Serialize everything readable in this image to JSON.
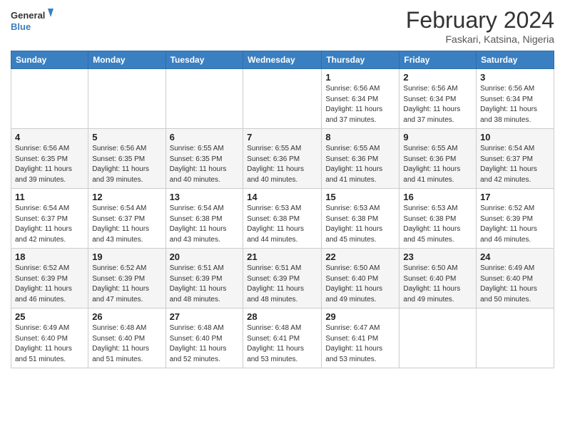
{
  "logo": {
    "line1": "General",
    "line2": "Blue"
  },
  "title": "February 2024",
  "location": "Faskari, Katsina, Nigeria",
  "days_of_week": [
    "Sunday",
    "Monday",
    "Tuesday",
    "Wednesday",
    "Thursday",
    "Friday",
    "Saturday"
  ],
  "weeks": [
    [
      {
        "day": "",
        "info": ""
      },
      {
        "day": "",
        "info": ""
      },
      {
        "day": "",
        "info": ""
      },
      {
        "day": "",
        "info": ""
      },
      {
        "day": "1",
        "info": "Sunrise: 6:56 AM\nSunset: 6:34 PM\nDaylight: 11 hours and 37 minutes."
      },
      {
        "day": "2",
        "info": "Sunrise: 6:56 AM\nSunset: 6:34 PM\nDaylight: 11 hours and 37 minutes."
      },
      {
        "day": "3",
        "info": "Sunrise: 6:56 AM\nSunset: 6:34 PM\nDaylight: 11 hours and 38 minutes."
      }
    ],
    [
      {
        "day": "4",
        "info": "Sunrise: 6:56 AM\nSunset: 6:35 PM\nDaylight: 11 hours and 39 minutes."
      },
      {
        "day": "5",
        "info": "Sunrise: 6:56 AM\nSunset: 6:35 PM\nDaylight: 11 hours and 39 minutes."
      },
      {
        "day": "6",
        "info": "Sunrise: 6:55 AM\nSunset: 6:35 PM\nDaylight: 11 hours and 40 minutes."
      },
      {
        "day": "7",
        "info": "Sunrise: 6:55 AM\nSunset: 6:36 PM\nDaylight: 11 hours and 40 minutes."
      },
      {
        "day": "8",
        "info": "Sunrise: 6:55 AM\nSunset: 6:36 PM\nDaylight: 11 hours and 41 minutes."
      },
      {
        "day": "9",
        "info": "Sunrise: 6:55 AM\nSunset: 6:36 PM\nDaylight: 11 hours and 41 minutes."
      },
      {
        "day": "10",
        "info": "Sunrise: 6:54 AM\nSunset: 6:37 PM\nDaylight: 11 hours and 42 minutes."
      }
    ],
    [
      {
        "day": "11",
        "info": "Sunrise: 6:54 AM\nSunset: 6:37 PM\nDaylight: 11 hours and 42 minutes."
      },
      {
        "day": "12",
        "info": "Sunrise: 6:54 AM\nSunset: 6:37 PM\nDaylight: 11 hours and 43 minutes."
      },
      {
        "day": "13",
        "info": "Sunrise: 6:54 AM\nSunset: 6:38 PM\nDaylight: 11 hours and 43 minutes."
      },
      {
        "day": "14",
        "info": "Sunrise: 6:53 AM\nSunset: 6:38 PM\nDaylight: 11 hours and 44 minutes."
      },
      {
        "day": "15",
        "info": "Sunrise: 6:53 AM\nSunset: 6:38 PM\nDaylight: 11 hours and 45 minutes."
      },
      {
        "day": "16",
        "info": "Sunrise: 6:53 AM\nSunset: 6:38 PM\nDaylight: 11 hours and 45 minutes."
      },
      {
        "day": "17",
        "info": "Sunrise: 6:52 AM\nSunset: 6:39 PM\nDaylight: 11 hours and 46 minutes."
      }
    ],
    [
      {
        "day": "18",
        "info": "Sunrise: 6:52 AM\nSunset: 6:39 PM\nDaylight: 11 hours and 46 minutes."
      },
      {
        "day": "19",
        "info": "Sunrise: 6:52 AM\nSunset: 6:39 PM\nDaylight: 11 hours and 47 minutes."
      },
      {
        "day": "20",
        "info": "Sunrise: 6:51 AM\nSunset: 6:39 PM\nDaylight: 11 hours and 48 minutes."
      },
      {
        "day": "21",
        "info": "Sunrise: 6:51 AM\nSunset: 6:39 PM\nDaylight: 11 hours and 48 minutes."
      },
      {
        "day": "22",
        "info": "Sunrise: 6:50 AM\nSunset: 6:40 PM\nDaylight: 11 hours and 49 minutes."
      },
      {
        "day": "23",
        "info": "Sunrise: 6:50 AM\nSunset: 6:40 PM\nDaylight: 11 hours and 49 minutes."
      },
      {
        "day": "24",
        "info": "Sunrise: 6:49 AM\nSunset: 6:40 PM\nDaylight: 11 hours and 50 minutes."
      }
    ],
    [
      {
        "day": "25",
        "info": "Sunrise: 6:49 AM\nSunset: 6:40 PM\nDaylight: 11 hours and 51 minutes."
      },
      {
        "day": "26",
        "info": "Sunrise: 6:48 AM\nSunset: 6:40 PM\nDaylight: 11 hours and 51 minutes."
      },
      {
        "day": "27",
        "info": "Sunrise: 6:48 AM\nSunset: 6:40 PM\nDaylight: 11 hours and 52 minutes."
      },
      {
        "day": "28",
        "info": "Sunrise: 6:48 AM\nSunset: 6:41 PM\nDaylight: 11 hours and 53 minutes."
      },
      {
        "day": "29",
        "info": "Sunrise: 6:47 AM\nSunset: 6:41 PM\nDaylight: 11 hours and 53 minutes."
      },
      {
        "day": "",
        "info": ""
      },
      {
        "day": "",
        "info": ""
      }
    ]
  ]
}
